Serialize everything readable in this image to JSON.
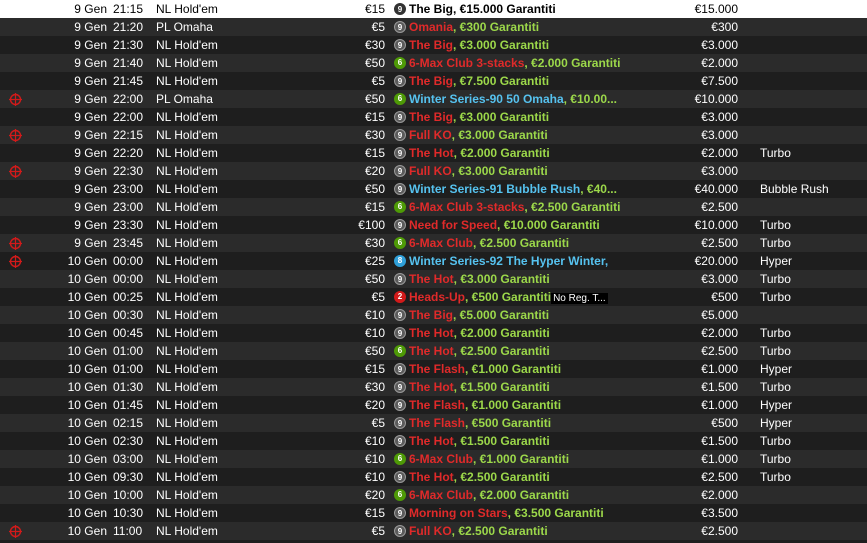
{
  "colors": {
    "row_dark": "#1e1e1e",
    "row_light": "#2b2b2b",
    "selected": "#ffffff",
    "name_red": "#e02a2a",
    "name_blue": "#56c2ef",
    "guarantee_green": "#9cd84a",
    "crosshair_red": "#d21a1a"
  },
  "icons": {
    "crosshair": "crosshair-icon",
    "seats": "seats-badge-icon"
  },
  "rows": [
    {
      "icon": false,
      "date": "9 Gen",
      "time": "21:15",
      "game": "NL Hold'em",
      "buyin": "€15",
      "seats": "9",
      "seat_color": "gray",
      "name": "The Big",
      "name_color": "black",
      "extra": "",
      "extra_color": "",
      "gtd": ", €15.000 Garantiti",
      "note": "",
      "guarantee": "€15.000",
      "type": "",
      "selected": true
    },
    {
      "icon": false,
      "date": "9 Gen",
      "time": "21:20",
      "game": "PL Omaha",
      "buyin": "€5",
      "seats": "9",
      "seat_color": "gray",
      "name": "Omania",
      "name_color": "red",
      "extra": "",
      "extra_color": "",
      "gtd": ", €300 Garantiti",
      "note": "",
      "guarantee": "€300",
      "type": "",
      "selected": false
    },
    {
      "icon": false,
      "date": "9 Gen",
      "time": "21:30",
      "game": "NL Hold'em",
      "buyin": "€30",
      "seats": "9",
      "seat_color": "gray",
      "name": "The Big",
      "name_color": "red",
      "extra": "",
      "extra_color": "",
      "gtd": ", €3.000 Garantiti",
      "note": "",
      "guarantee": "€3.000",
      "type": "",
      "selected": false
    },
    {
      "icon": false,
      "date": "9 Gen",
      "time": "21:40",
      "game": "NL Hold'em",
      "buyin": "€50",
      "seats": "6",
      "seat_color": "green",
      "name": "6-Max Club",
      "name_color": "red",
      "extra": " 3-stacks",
      "extra_color": "red",
      "gtd": ", €2.000 Garantiti",
      "note": "",
      "guarantee": "€2.000",
      "type": "",
      "selected": false
    },
    {
      "icon": false,
      "date": "9 Gen",
      "time": "21:45",
      "game": "NL Hold'em",
      "buyin": "€5",
      "seats": "9",
      "seat_color": "gray",
      "name": "The Big",
      "name_color": "red",
      "extra": "",
      "extra_color": "",
      "gtd": ", €7.500 Garantiti",
      "note": "",
      "guarantee": "€7.500",
      "type": "",
      "selected": false
    },
    {
      "icon": true,
      "date": "9 Gen",
      "time": "22:00",
      "game": "PL Omaha",
      "buyin": "€50",
      "seats": "6",
      "seat_color": "green",
      "name": "Winter Series-90 50 Omaha",
      "name_color": "blue",
      "extra": "",
      "extra_color": "",
      "gtd": ", €10.00...",
      "note": "",
      "guarantee": "€10.000",
      "type": "",
      "selected": false
    },
    {
      "icon": false,
      "date": "9 Gen",
      "time": "22:00",
      "game": "NL Hold'em",
      "buyin": "€15",
      "seats": "9",
      "seat_color": "gray",
      "name": "The Big",
      "name_color": "red",
      "extra": "",
      "extra_color": "",
      "gtd": ", €3.000 Garantiti",
      "note": "",
      "guarantee": "€3.000",
      "type": "",
      "selected": false
    },
    {
      "icon": true,
      "date": "9 Gen",
      "time": "22:15",
      "game": "NL Hold'em",
      "buyin": "€30",
      "seats": "9",
      "seat_color": "gray",
      "name": "Full KO",
      "name_color": "red",
      "extra": "",
      "extra_color": "",
      "gtd": ", €3.000 Garantiti",
      "note": "",
      "guarantee": "€3.000",
      "type": "",
      "selected": false
    },
    {
      "icon": false,
      "date": "9 Gen",
      "time": "22:20",
      "game": "NL Hold'em",
      "buyin": "€15",
      "seats": "9",
      "seat_color": "gray",
      "name": "The Hot",
      "name_color": "red",
      "extra": "",
      "extra_color": "",
      "gtd": ", €2.000 Garantiti",
      "note": "",
      "guarantee": "€2.000",
      "type": "Turbo",
      "selected": false
    },
    {
      "icon": true,
      "date": "9 Gen",
      "time": "22:30",
      "game": "NL Hold'em",
      "buyin": "€20",
      "seats": "9",
      "seat_color": "gray",
      "name": "Full KO",
      "name_color": "red",
      "extra": "",
      "extra_color": "",
      "gtd": ", €3.000 Garantiti",
      "note": "",
      "guarantee": "€3.000",
      "type": "",
      "selected": false
    },
    {
      "icon": false,
      "date": "9 Gen",
      "time": "23:00",
      "game": "NL Hold'em",
      "buyin": "€50",
      "seats": "9",
      "seat_color": "gray",
      "name": "Winter Series-91 Bubble Rush",
      "name_color": "blue",
      "extra": "",
      "extra_color": "",
      "gtd": ", €40...",
      "note": "",
      "guarantee": "€40.000",
      "type": "Bubble Rush",
      "selected": false
    },
    {
      "icon": false,
      "date": "9 Gen",
      "time": "23:00",
      "game": "NL Hold'em",
      "buyin": "€15",
      "seats": "6",
      "seat_color": "green",
      "name": "6-Max Club",
      "name_color": "red",
      "extra": " 3-stacks",
      "extra_color": "red",
      "gtd": ", €2.500 Garantiti",
      "note": "",
      "guarantee": "€2.500",
      "type": "",
      "selected": false
    },
    {
      "icon": false,
      "date": "9 Gen",
      "time": "23:30",
      "game": "NL Hold'em",
      "buyin": "€100",
      "seats": "9",
      "seat_color": "gray",
      "name": "Need for Speed",
      "name_color": "red",
      "extra": "",
      "extra_color": "",
      "gtd": ", €10.000 Garantiti",
      "note": "",
      "guarantee": "€10.000",
      "type": "Turbo",
      "selected": false
    },
    {
      "icon": true,
      "date": "9 Gen",
      "time": "23:45",
      "game": "NL Hold'em",
      "buyin": "€30",
      "seats": "6",
      "seat_color": "green",
      "name": "6-Max Club",
      "name_color": "red",
      "extra": "",
      "extra_color": "",
      "gtd": ", €2.500 Garantiti",
      "note": "",
      "guarantee": "€2.500",
      "type": "Turbo",
      "selected": false
    },
    {
      "icon": true,
      "date": "10 Gen",
      "time": "00:00",
      "game": "NL Hold'em",
      "buyin": "€25",
      "seats": "8",
      "seat_color": "blue",
      "name": "Winter Series-92 The Hyper Winter,",
      "name_color": "blue",
      "extra": "",
      "extra_color": "",
      "gtd": "",
      "note": "",
      "guarantee": "€20.000",
      "type": "Hyper",
      "selected": false
    },
    {
      "icon": false,
      "date": "10 Gen",
      "time": "00:00",
      "game": "NL Hold'em",
      "buyin": "€50",
      "seats": "9",
      "seat_color": "gray",
      "name": "The Hot",
      "name_color": "red",
      "extra": "",
      "extra_color": "",
      "gtd": ", €3.000 Garantiti",
      "note": "",
      "guarantee": "€3.000",
      "type": "Turbo",
      "selected": false
    },
    {
      "icon": false,
      "date": "10 Gen",
      "time": "00:25",
      "game": "NL Hold'em",
      "buyin": "€5",
      "seats": "2",
      "seat_color": "red",
      "name": "Heads-Up",
      "name_color": "red",
      "extra": "",
      "extra_color": "",
      "gtd": ", €500 Garantiti",
      "note": "No Reg. T...",
      "guarantee": "€500",
      "type": "Turbo",
      "selected": false
    },
    {
      "icon": false,
      "date": "10 Gen",
      "time": "00:30",
      "game": "NL Hold'em",
      "buyin": "€10",
      "seats": "9",
      "seat_color": "gray",
      "name": "The Big",
      "name_color": "red",
      "extra": "",
      "extra_color": "",
      "gtd": ", €5.000 Garantiti",
      "note": "",
      "guarantee": "€5.000",
      "type": "",
      "selected": false
    },
    {
      "icon": false,
      "date": "10 Gen",
      "time": "00:45",
      "game": "NL Hold'em",
      "buyin": "€10",
      "seats": "9",
      "seat_color": "gray",
      "name": "The Hot",
      "name_color": "red",
      "extra": "",
      "extra_color": "",
      "gtd": ", €2.000 Garantiti",
      "note": "",
      "guarantee": "€2.000",
      "type": "Turbo",
      "selected": false
    },
    {
      "icon": false,
      "date": "10 Gen",
      "time": "01:00",
      "game": "NL Hold'em",
      "buyin": "€50",
      "seats": "6",
      "seat_color": "green",
      "name": "The Hot",
      "name_color": "red",
      "extra": "",
      "extra_color": "",
      "gtd": ", €2.500 Garantiti",
      "note": "",
      "guarantee": "€2.500",
      "type": "Turbo",
      "selected": false
    },
    {
      "icon": false,
      "date": "10 Gen",
      "time": "01:00",
      "game": "NL Hold'em",
      "buyin": "€15",
      "seats": "9",
      "seat_color": "gray",
      "name": "The Flash",
      "name_color": "red",
      "extra": "",
      "extra_color": "",
      "gtd": ", €1.000 Garantiti",
      "note": "",
      "guarantee": "€1.000",
      "type": "Hyper",
      "selected": false
    },
    {
      "icon": false,
      "date": "10 Gen",
      "time": "01:30",
      "game": "NL Hold'em",
      "buyin": "€30",
      "seats": "9",
      "seat_color": "gray",
      "name": "The Hot",
      "name_color": "red",
      "extra": "",
      "extra_color": "",
      "gtd": ", €1.500 Garantiti",
      "note": "",
      "guarantee": "€1.500",
      "type": "Turbo",
      "selected": false
    },
    {
      "icon": false,
      "date": "10 Gen",
      "time": "01:45",
      "game": "NL Hold'em",
      "buyin": "€20",
      "seats": "9",
      "seat_color": "gray",
      "name": "The Flash",
      "name_color": "red",
      "extra": "",
      "extra_color": "",
      "gtd": ", €1.000 Garantiti",
      "note": "",
      "guarantee": "€1.000",
      "type": "Hyper",
      "selected": false
    },
    {
      "icon": false,
      "date": "10 Gen",
      "time": "02:15",
      "game": "NL Hold'em",
      "buyin": "€5",
      "seats": "9",
      "seat_color": "gray",
      "name": "The Flash",
      "name_color": "red",
      "extra": "",
      "extra_color": "",
      "gtd": ", €500 Garantiti",
      "note": "",
      "guarantee": "€500",
      "type": "Hyper",
      "selected": false
    },
    {
      "icon": false,
      "date": "10 Gen",
      "time": "02:30",
      "game": "NL Hold'em",
      "buyin": "€10",
      "seats": "9",
      "seat_color": "gray",
      "name": "The Hot",
      "name_color": "red",
      "extra": "",
      "extra_color": "",
      "gtd": ", €1.500 Garantiti",
      "note": "",
      "guarantee": "€1.500",
      "type": "Turbo",
      "selected": false
    },
    {
      "icon": false,
      "date": "10 Gen",
      "time": "03:00",
      "game": "NL Hold'em",
      "buyin": "€10",
      "seats": "6",
      "seat_color": "green",
      "name": "6-Max Club",
      "name_color": "red",
      "extra": "",
      "extra_color": "",
      "gtd": ", €1.000 Garantiti",
      "note": "",
      "guarantee": "€1.000",
      "type": "Turbo",
      "selected": false
    },
    {
      "icon": false,
      "date": "10 Gen",
      "time": "09:30",
      "game": "NL Hold'em",
      "buyin": "€10",
      "seats": "9",
      "seat_color": "gray",
      "name": "The Hot",
      "name_color": "red",
      "extra": "",
      "extra_color": "",
      "gtd": ", €2.500 Garantiti",
      "note": "",
      "guarantee": "€2.500",
      "type": "Turbo",
      "selected": false
    },
    {
      "icon": false,
      "date": "10 Gen",
      "time": "10:00",
      "game": "NL Hold'em",
      "buyin": "€20",
      "seats": "6",
      "seat_color": "green",
      "name": "6-Max Club",
      "name_color": "red",
      "extra": "",
      "extra_color": "",
      "gtd": ", €2.000 Garantiti",
      "note": "",
      "guarantee": "€2.000",
      "type": "",
      "selected": false
    },
    {
      "icon": false,
      "date": "10 Gen",
      "time": "10:30",
      "game": "NL Hold'em",
      "buyin": "€15",
      "seats": "9",
      "seat_color": "gray",
      "name": "Morning on Stars",
      "name_color": "red",
      "extra": "",
      "extra_color": "",
      "gtd": ", €3.500 Garantiti",
      "note": "",
      "guarantee": "€3.500",
      "type": "",
      "selected": false
    },
    {
      "icon": true,
      "date": "10 Gen",
      "time": "11:00",
      "game": "NL Hold'em",
      "buyin": "€5",
      "seats": "9",
      "seat_color": "gray",
      "name": "Full KO",
      "name_color": "red",
      "extra": "",
      "extra_color": "",
      "gtd": ", €2.500 Garantiti",
      "note": "",
      "guarantee": "€2.500",
      "type": "",
      "selected": false
    }
  ]
}
